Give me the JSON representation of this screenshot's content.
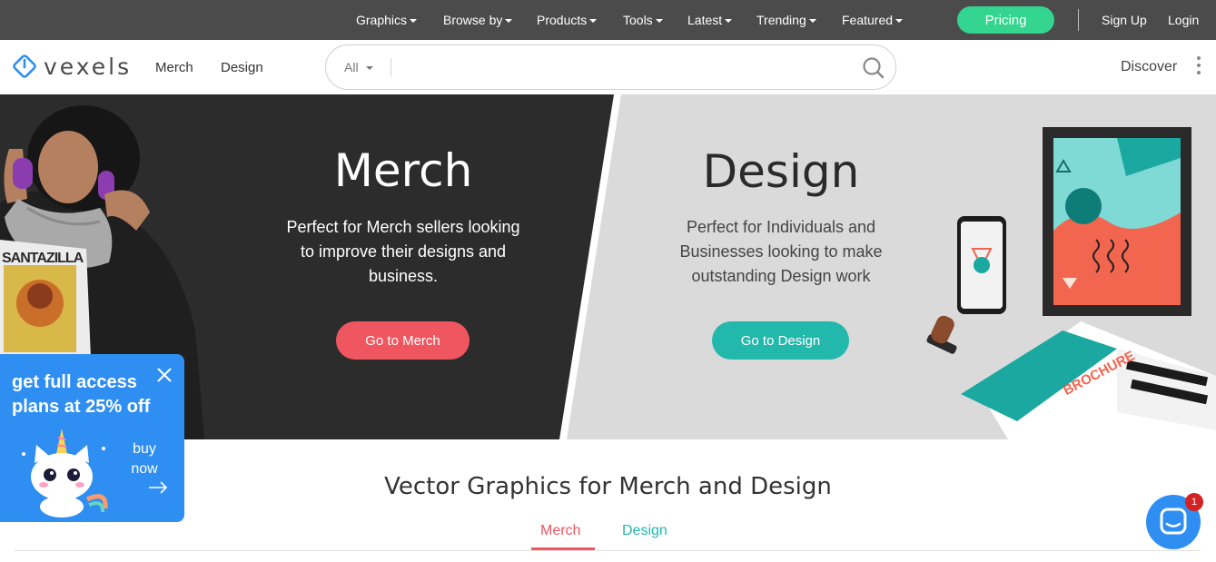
{
  "topbar": {
    "nav": [
      {
        "label": "Graphics"
      },
      {
        "label": "Browse by"
      },
      {
        "label": "Products"
      },
      {
        "label": "Tools"
      },
      {
        "label": "Latest"
      },
      {
        "label": "Trending"
      },
      {
        "label": "Featured"
      }
    ],
    "pricing_label": "Pricing",
    "signup_label": "Sign Up",
    "login_label": "Login"
  },
  "header": {
    "logo_text": "vexels",
    "nav": [
      {
        "label": "Merch"
      },
      {
        "label": "Design"
      }
    ],
    "search": {
      "category": "All",
      "placeholder": "",
      "value": ""
    },
    "discover_label": "Discover"
  },
  "hero": {
    "merch": {
      "title": "Merch",
      "description_lines": [
        "Perfect for Merch sellers looking",
        "to improve their designs and",
        "business."
      ],
      "button_label": "Go to Merch"
    },
    "design": {
      "title": "Design",
      "description_lines": [
        "Perfect for Individuals and",
        "Businesses looking to make",
        "outstanding Design work"
      ],
      "button_label": "Go to Design"
    },
    "tshirt_text": "SANTAZILLA",
    "brochure_text": "BROCHURE"
  },
  "promo": {
    "title_lines": [
      "get full access",
      "plans at 25% off"
    ],
    "buy_lines": [
      "buy",
      "now"
    ]
  },
  "section": {
    "title": "Vector Graphics for Merch and Design",
    "tabs": [
      {
        "label": "Merch",
        "active": true
      },
      {
        "label": "Design",
        "active": false
      }
    ]
  },
  "chat": {
    "badge_count": "1"
  },
  "colors": {
    "topbar_bg": "#4b4b4b",
    "pricing_green": "#34d58f",
    "merch_red": "#f0565f",
    "design_teal": "#23b8ac",
    "promo_blue": "#2f8ef2"
  }
}
